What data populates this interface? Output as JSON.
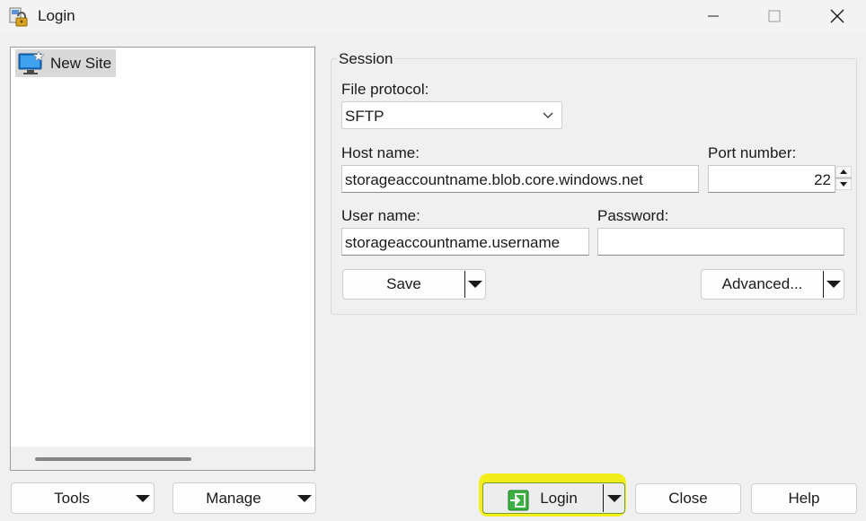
{
  "window": {
    "title": "Login",
    "icon": "winscp-lock-icon",
    "controls": {
      "minimize_icon": "minimize-icon",
      "maximize_icon": "maximize-icon",
      "close_icon": "close-icon"
    }
  },
  "site_tree": {
    "items": [
      {
        "label": "New Site",
        "icon": "new-site-monitor-icon",
        "selected": true
      }
    ]
  },
  "session": {
    "group_label": "Session",
    "file_protocol": {
      "label": "File protocol:",
      "value": "SFTP"
    },
    "host_name": {
      "label": "Host name:",
      "value": "storageaccountname.blob.core.windows.net"
    },
    "port_number": {
      "label": "Port number:",
      "value": "22"
    },
    "user_name": {
      "label": "User name:",
      "value": "storageaccountname.username"
    },
    "password": {
      "label": "Password:",
      "value": ""
    },
    "save_label": "Save",
    "advanced_label": "Advanced..."
  },
  "footer": {
    "tools_label": "Tools",
    "manage_label": "Manage",
    "login_label": "Login",
    "close_label": "Close",
    "help_label": "Help"
  },
  "colors": {
    "highlight": "#f2ee1c",
    "login_icon_green": "#3cb043",
    "background": "#f0f0f0"
  }
}
